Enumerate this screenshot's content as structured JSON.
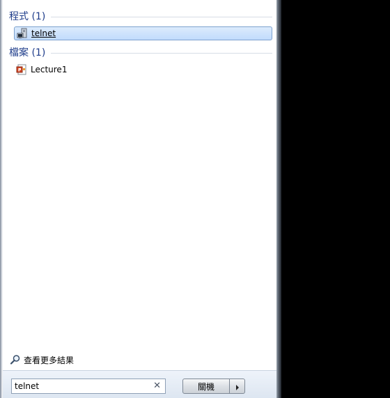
{
  "results": {
    "groups": [
      {
        "title": "程式 (1)",
        "items": [
          {
            "label": "telnet",
            "icon": "telnet-program-icon",
            "selected": true
          }
        ]
      },
      {
        "title": "檔案 (1)",
        "items": [
          {
            "label": "Lecture1",
            "icon": "powerpoint-file-icon",
            "selected": false
          }
        ]
      }
    ]
  },
  "see_more": {
    "label": "查看更多結果",
    "icon": "search-icon"
  },
  "search": {
    "value": "telnet",
    "clear_icon": "close-icon"
  },
  "shutdown": {
    "label": "關機",
    "arrow_icon": "arrow-right-icon"
  },
  "colors": {
    "group_title": "#1e3c8a",
    "selection_border": "#7da2ce",
    "selection_fill": "#c1dbfc"
  }
}
